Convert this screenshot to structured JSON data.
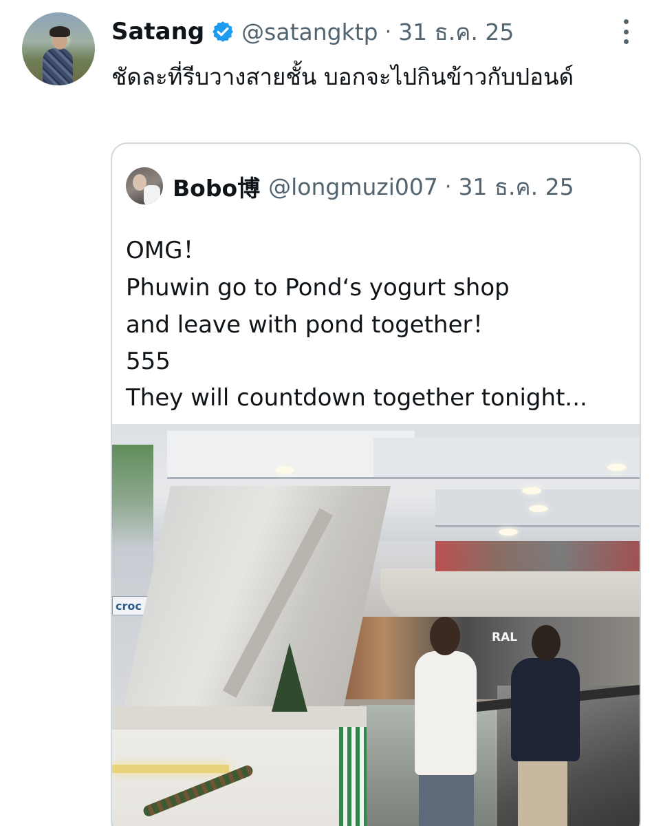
{
  "tweet": {
    "author_name": "Satang",
    "author_handle": "@satangktp",
    "separator": "·",
    "date": "31 ธ.ค. 25",
    "text": "ชัดละที่รีบวางสายชั้น บอกจะไปกินข้าวกับปอนด์"
  },
  "quoted_tweet": {
    "author_name": "Bobo博",
    "author_handle": "@longmuzi007",
    "separator": "·",
    "date": "31 ธ.ค. 25",
    "lines": [
      "OMG！",
      "Phuwin go to Pond‘s yogurt shop",
      "and leave with pond together！",
      "555",
      "They will countdown together tonight..."
    ],
    "media_alt": ""
  },
  "colors": {
    "text_primary": "#0f1419",
    "text_secondary": "#536471",
    "verified_blue": "#1d9bf0",
    "card_border": "#cfd9de"
  },
  "icons": {
    "verified": "verified-badge-icon",
    "more": "more-vertical-icon"
  }
}
